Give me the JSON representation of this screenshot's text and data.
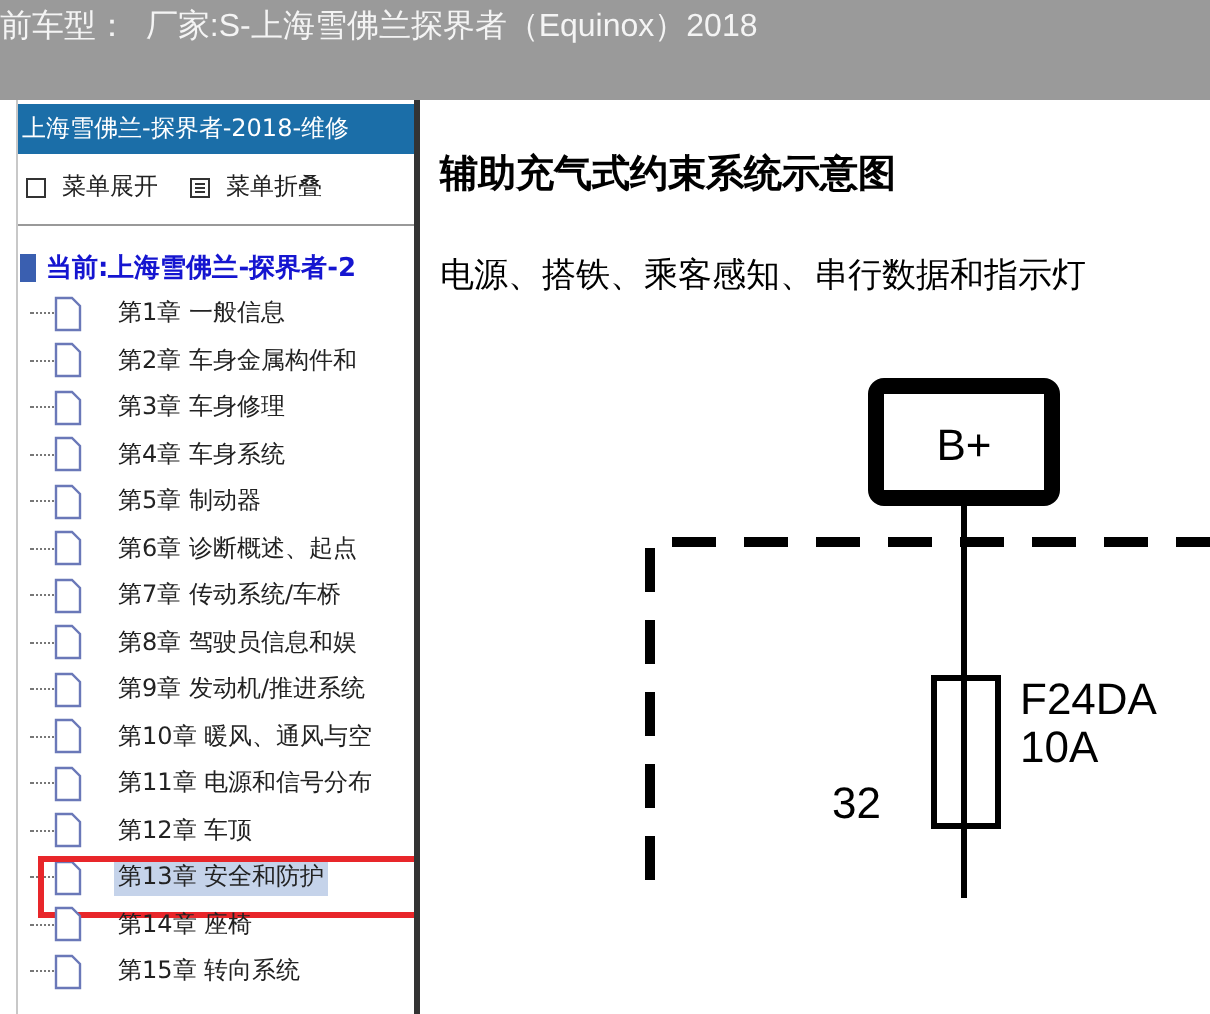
{
  "header": {
    "title": "前车型：  厂家:S-上海雪佛兰探界者（Equinox）2018"
  },
  "sidebar": {
    "title": "上海雪佛兰-探界者-2018-维修",
    "toolbar": [
      {
        "kind": "expand",
        "label": "菜单展开"
      },
      {
        "kind": "collapse",
        "label": "菜单折叠"
      }
    ],
    "tree": {
      "label": "当前:上海雪佛兰-探界者-2",
      "children": [
        {
          "label": "第1章 一般信息",
          "selected": false,
          "outlined": false
        },
        {
          "label": "第2章 车身金属构件和",
          "selected": false,
          "outlined": false
        },
        {
          "label": "第3章 车身修理",
          "selected": false,
          "outlined": false
        },
        {
          "label": "第4章 车身系统",
          "selected": false,
          "outlined": false
        },
        {
          "label": "第5章 制动器",
          "selected": false,
          "outlined": false
        },
        {
          "label": "第6章 诊断概述、起点",
          "selected": false,
          "outlined": false
        },
        {
          "label": "第7章 传动系统/车桥",
          "selected": false,
          "outlined": false
        },
        {
          "label": "第8章 驾驶员信息和娱",
          "selected": false,
          "outlined": false
        },
        {
          "label": "第9章 发动机/推进系统",
          "selected": false,
          "outlined": false
        },
        {
          "label": "第10章 暖风、通风与空",
          "selected": false,
          "outlined": false
        },
        {
          "label": "第11章 电源和信号分布",
          "selected": false,
          "outlined": false
        },
        {
          "label": "第12章 车顶",
          "selected": false,
          "outlined": false
        },
        {
          "label": "第13章 安全和防护",
          "selected": true,
          "outlined": true
        },
        {
          "label": "第14章 座椅",
          "selected": false,
          "outlined": false
        },
        {
          "label": "第15章 转向系统",
          "selected": false,
          "outlined": false
        }
      ]
    }
  },
  "content": {
    "heading": "辅助充气式约束系统示意图",
    "subheading": "电源、搭铁、乘客感知、串行数据和指示灯",
    "diagram": {
      "terminal": "B+",
      "fuse_name": "F24DA",
      "fuse_rating": "10A",
      "pin": "32"
    }
  }
}
